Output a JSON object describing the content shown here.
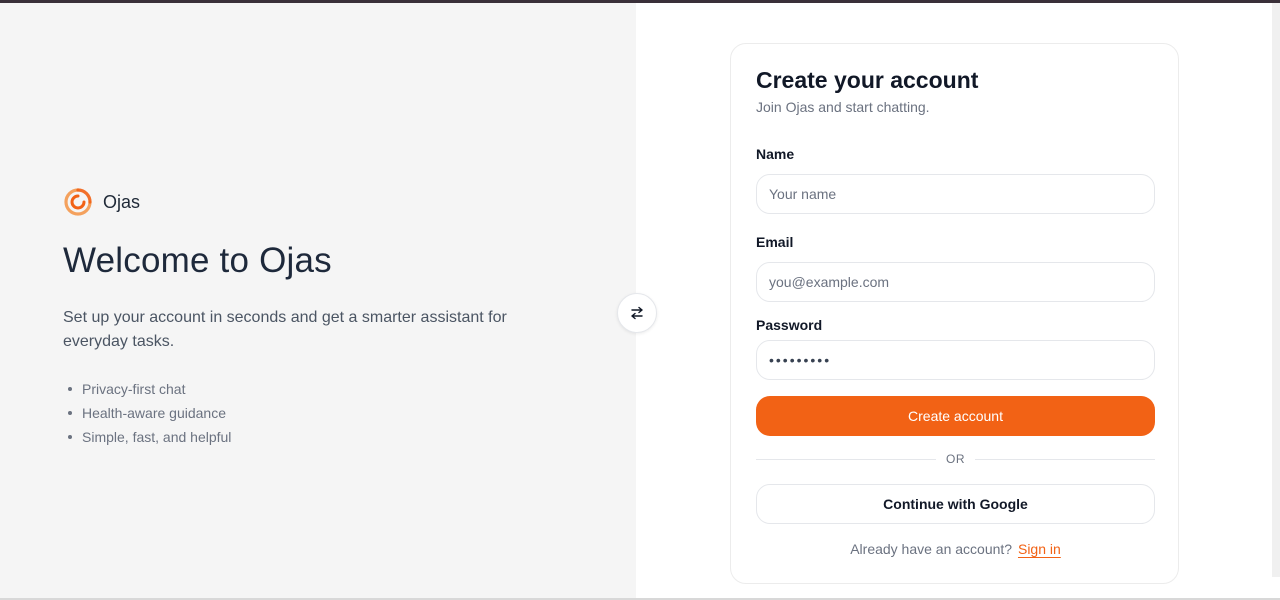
{
  "brand": {
    "name": "Ojas",
    "logo_icon": "ojas-spiral-logo",
    "accent_color": "#f26215"
  },
  "hero": {
    "title": "Welcome to Ojas",
    "subtitle": "Set up your account in seconds and get a smarter assistant for everyday tasks.",
    "features": [
      "Privacy-first chat",
      "Health-aware guidance",
      "Simple, fast, and helpful"
    ]
  },
  "swap": {
    "icon": "swap-arrows-icon"
  },
  "form": {
    "title": "Create your account",
    "subtitle": "Join Ojas and start chatting.",
    "name": {
      "label": "Name",
      "placeholder": "Your name",
      "value": ""
    },
    "email": {
      "label": "Email",
      "placeholder": "you@example.com",
      "value": ""
    },
    "password": {
      "label": "Password",
      "value": "•••••••••"
    },
    "submit_label": "Create account",
    "divider_text": "OR",
    "google_label": "Continue with Google",
    "signin_prompt": "Already have an account?",
    "signin_link": "Sign in"
  }
}
